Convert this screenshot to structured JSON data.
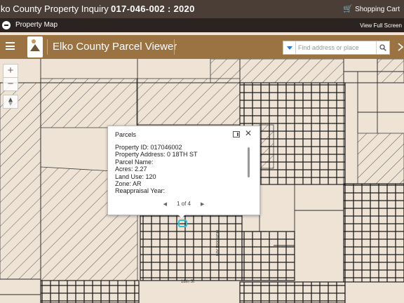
{
  "topbar": {
    "title": "lko County Property Inquiry",
    "property_id": "017-046-002 : 2020",
    "cart_label": "Shopping Cart"
  },
  "mapbar": {
    "label": "Property Map",
    "full_screen": "View Full Screen"
  },
  "header": {
    "app_title": "Elko County Parcel Viewer"
  },
  "search": {
    "placeholder": "Find address or place"
  },
  "popup": {
    "title": "Parcels",
    "lines": [
      "Property ID: 017046002",
      "Property Address: 0 18TH ST",
      "Parcel Name:",
      "Acres: 2.27",
      "Land Use: 120",
      "Zone: AR",
      "Reappraisal Year:"
    ],
    "pager": "1 of 4"
  },
  "map": {
    "street_labels": [
      "18th St",
      "Humboldt Ave"
    ]
  },
  "colors": {
    "header": "#9b7343",
    "topbar": "#4a3e36",
    "map_bg": "#efe3d6",
    "marker": "#2fc0d8",
    "search_dropdown": "#2b7ac6"
  }
}
